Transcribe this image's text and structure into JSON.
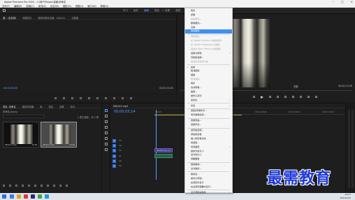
{
  "titlebar": {
    "title": "Adobe Premiere Pro 2020 - C:\\用户\\Peipei\\桌面\\未命名"
  },
  "menubar": {
    "items": [
      "文件(F)",
      "编辑(E)",
      "剪辑(C)",
      "序列(S)",
      "标记(M)",
      "图形(G)",
      "视图(V)",
      "窗口(W)",
      "帮助(H)"
    ]
  },
  "workspace": {
    "tabs": [
      "学习",
      "组件",
      "编辑",
      "颜色",
      "效果",
      "音频"
    ],
    "active_index": 2
  },
  "source_panel": {
    "tabs": [
      "源：(无剪辑)",
      "效果控件",
      "音频剪辑混合器：000101",
      "元数据"
    ],
    "timecode": "00;00;00;00",
    "duration": "00;00;00;00"
  },
  "program_panel": {
    "fit_label": "完整",
    "timecode_left": "00;00;02;28",
    "timecode_right": "00;00;15;28"
  },
  "project_panel": {
    "tabs": [
      "项目: 未命名",
      "媒体浏览器",
      "库",
      "信息",
      "效果",
      "标记",
      "历史记录"
    ],
    "subtitle": "未命名.prproj",
    "count": "1 项已选择，共 2 项",
    "items": [
      {
        "label": "000101.mp4",
        "duration": "15;28"
      },
      {
        "label": "000101.mp4",
        "duration": "15;28"
      }
    ]
  },
  "timeline": {
    "tab": "000101.mp4",
    "timecode": "00;00;03;14",
    "ruler_marks": [
      "00;00",
      "00;00;16;00",
      "00;00;32;00",
      "00;00;48;00",
      "00;01;04;02",
      "00;01;20;02"
    ],
    "tracks": [
      "V3",
      "V2",
      "V1",
      "A1",
      "A2",
      "A3"
    ],
    "clip_label": "000101.mp4 [V]"
  },
  "context_menu": {
    "items": [
      {
        "label": "剪切",
        "state": "normal"
      },
      {
        "label": "复制",
        "state": "normal"
      },
      {
        "label": "粘贴属性...",
        "state": "disabled"
      },
      {
        "label": "删除属性...",
        "state": "normal"
      },
      {
        "label": "清除",
        "state": "normal"
      },
      {
        "label": "波纹删除",
        "state": "highlight"
      },
      {
        "sep": true
      },
      {
        "label": "编辑原始",
        "state": "disabled"
      },
      {
        "label": "在 Adobe Audition 中编辑剪辑",
        "state": "disabled"
      },
      {
        "label": "在 Adobe Photoshop 中编辑",
        "state": "disabled"
      },
      {
        "label": "替换为 After Effects 合成图像",
        "state": "disabled"
      },
      {
        "label": "替换为剪辑",
        "state": "submenu"
      },
      {
        "label": "渲染和替换...",
        "state": "normal"
      },
      {
        "label": "恢复未渲染的内容",
        "state": "disabled"
      },
      {
        "sep": true
      },
      {
        "label": "启用",
        "state": "check"
      },
      {
        "label": "取消链接",
        "state": "normal"
      },
      {
        "label": "编组",
        "state": "normal"
      },
      {
        "label": "取消编组",
        "state": "disabled"
      },
      {
        "label": "同步",
        "state": "normal"
      },
      {
        "label": "合并剪辑...",
        "state": "normal"
      },
      {
        "label": "嵌套...",
        "state": "normal"
      },
      {
        "label": "制作子序列",
        "state": "normal"
      },
      {
        "label": "多机位",
        "state": "submenu"
      },
      {
        "sep": true
      },
      {
        "label": "标签",
        "state": "submenu"
      },
      {
        "sep": true
      },
      {
        "label": "速度/持续时间...",
        "state": "normal"
      },
      {
        "label": "场景编辑检测...",
        "state": "normal"
      },
      {
        "sep": true
      },
      {
        "label": "音频增益...",
        "state": "normal"
      },
      {
        "label": "音频声道...",
        "state": "normal"
      },
      {
        "sep": true
      },
      {
        "label": "帧定格选项...",
        "state": "normal"
      },
      {
        "label": "添加帧定格",
        "state": "normal"
      },
      {
        "label": "插入帧定格分段",
        "state": "normal"
      },
      {
        "label": "场选项...",
        "state": "normal"
      },
      {
        "label": "时间插值",
        "state": "submenu"
      },
      {
        "label": "缩放为帧大小",
        "state": "normal"
      },
      {
        "label": "设为帧大小",
        "state": "normal"
      },
      {
        "label": "调整图层",
        "state": "normal"
      },
      {
        "sep": true
      },
      {
        "label": "链接媒体...",
        "state": "normal"
      },
      {
        "label": "设为脱机...",
        "state": "normal"
      },
      {
        "sep": true
      },
      {
        "label": "重命名...",
        "state": "normal"
      },
      {
        "label": "制作子剪辑...",
        "state": "normal"
      },
      {
        "label": "在项目中显示",
        "state": "normal"
      },
      {
        "label": "在资源管理器中显示...",
        "state": "normal"
      },
      {
        "sep": true
      },
      {
        "label": "显示剪辑关键帧",
        "state": "submenu"
      }
    ]
  },
  "watermark": {
    "text": "最需教育"
  },
  "taskbar": {
    "time": "14:07",
    "date": "2021/5/22"
  },
  "colors": {
    "accent": "#5b9bff",
    "menu_highlight": "#3f8ff0",
    "watermark": "#1e38d8"
  }
}
